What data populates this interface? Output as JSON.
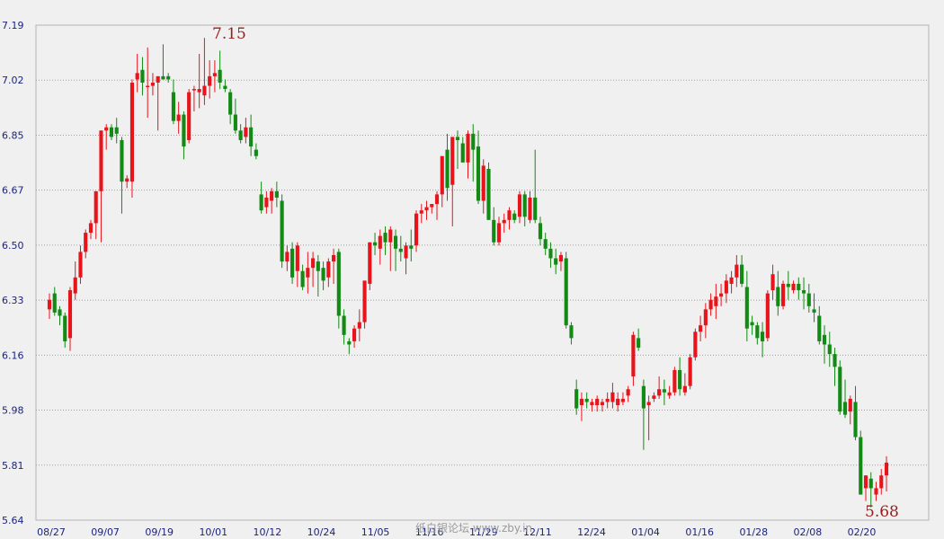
{
  "chart_data": {
    "type": "candlestick",
    "title": "",
    "xlabel": "",
    "ylabel": "",
    "ylim": [
      5.64,
      7.19
    ],
    "yticks": [
      "7.19",
      "7.02",
      "6.85",
      "6.67",
      "6.50",
      "6.33",
      "6.16",
      "5.98",
      "5.81",
      "5.64"
    ],
    "xticks": [
      "08/27",
      "09/07",
      "09/19",
      "10/01",
      "10/12",
      "10/24",
      "11/05",
      "11/16",
      "11/29",
      "12/11",
      "12/24",
      "01/04",
      "01/16",
      "01/28",
      "02/08",
      "02/20"
    ],
    "grid": "horizontal dotted",
    "high_label": "7.15",
    "low_label": "5.68",
    "up_color": "#e8141b",
    "down_color": "#128a14",
    "watermark": "纸白银论坛 www.zby.in",
    "candles": [
      [
        6.3,
        6.35,
        6.27,
        6.33
      ],
      [
        6.35,
        6.37,
        6.28,
        6.29
      ],
      [
        6.3,
        6.31,
        6.25,
        6.28
      ],
      [
        6.28,
        6.29,
        6.18,
        6.2
      ],
      [
        6.21,
        6.37,
        6.17,
        6.36
      ],
      [
        6.35,
        6.45,
        6.33,
        6.4
      ],
      [
        6.4,
        6.5,
        6.38,
        6.48
      ],
      [
        6.48,
        6.55,
        6.46,
        6.54
      ],
      [
        6.54,
        6.58,
        6.52,
        6.57
      ],
      [
        6.57,
        6.67,
        6.52,
        6.67
      ],
      [
        6.67,
        6.86,
        6.51,
        6.86
      ],
      [
        6.86,
        6.88,
        6.8,
        6.87
      ],
      [
        6.87,
        6.88,
        6.83,
        6.84
      ],
      [
        6.87,
        6.9,
        6.82,
        6.85
      ],
      [
        6.83,
        6.84,
        6.6,
        6.7
      ],
      [
        6.7,
        6.72,
        6.68,
        6.71
      ],
      [
        6.7,
        7.02,
        6.65,
        7.01
      ],
      [
        7.02,
        7.1,
        6.98,
        7.04
      ],
      [
        7.05,
        7.09,
        6.97,
        7.01
      ],
      [
        7.0,
        7.12,
        6.9,
        7.0
      ],
      [
        7.0,
        7.04,
        6.97,
        7.01
      ],
      [
        7.01,
        7.03,
        6.86,
        7.03
      ],
      [
        7.03,
        7.13,
        7.02,
        7.02
      ],
      [
        7.03,
        7.04,
        7.01,
        7.02
      ],
      [
        6.98,
        7.02,
        6.88,
        6.89
      ],
      [
        6.89,
        6.95,
        6.85,
        6.91
      ],
      [
        6.91,
        6.92,
        6.77,
        6.81
      ],
      [
        6.83,
        6.99,
        6.82,
        6.98
      ],
      [
        6.99,
        7.0,
        6.92,
        6.99
      ],
      [
        6.98,
        7.1,
        6.93,
        6.99
      ],
      [
        6.97,
        7.15,
        6.94,
        7.0
      ],
      [
        7.0,
        7.08,
        6.96,
        7.03
      ],
      [
        7.03,
        7.08,
        6.98,
        7.04
      ],
      [
        7.05,
        7.11,
        6.99,
        7.01
      ],
      [
        7.0,
        7.02,
        6.98,
        6.99
      ],
      [
        6.98,
        6.99,
        6.88,
        6.91
      ],
      [
        6.91,
        6.96,
        6.85,
        6.86
      ],
      [
        6.86,
        6.88,
        6.82,
        6.83
      ],
      [
        6.84,
        6.9,
        6.82,
        6.87
      ],
      [
        6.87,
        6.91,
        6.78,
        6.81
      ],
      [
        6.8,
        6.82,
        6.77,
        6.78
      ],
      [
        6.66,
        6.7,
        6.6,
        6.61
      ],
      [
        6.62,
        6.67,
        6.6,
        6.65
      ],
      [
        6.64,
        6.68,
        6.6,
        6.67
      ],
      [
        6.67,
        6.7,
        6.62,
        6.65
      ],
      [
        6.64,
        6.66,
        6.43,
        6.45
      ],
      [
        6.45,
        6.5,
        6.42,
        6.48
      ],
      [
        6.49,
        6.51,
        6.38,
        6.4
      ],
      [
        6.42,
        6.51,
        6.37,
        6.5
      ],
      [
        6.42,
        6.44,
        6.36,
        6.37
      ],
      [
        6.4,
        6.48,
        6.35,
        6.43
      ],
      [
        6.43,
        6.48,
        6.37,
        6.46
      ],
      [
        6.45,
        6.47,
        6.34,
        6.42
      ],
      [
        6.43,
        6.45,
        6.36,
        6.39
      ],
      [
        6.4,
        6.46,
        6.37,
        6.45
      ],
      [
        6.45,
        6.49,
        6.38,
        6.47
      ],
      [
        6.48,
        6.49,
        6.24,
        6.28
      ],
      [
        6.28,
        6.3,
        6.19,
        6.22
      ],
      [
        6.2,
        6.21,
        6.16,
        6.19
      ],
      [
        6.2,
        6.25,
        6.18,
        6.24
      ],
      [
        6.24,
        6.3,
        6.2,
        6.26
      ],
      [
        6.26,
        6.39,
        6.24,
        6.39
      ],
      [
        6.38,
        6.51,
        6.36,
        6.51
      ],
      [
        6.51,
        6.54,
        6.47,
        6.5
      ],
      [
        6.49,
        6.55,
        6.44,
        6.53
      ],
      [
        6.54,
        6.56,
        6.47,
        6.51
      ],
      [
        6.51,
        6.56,
        6.42,
        6.55
      ],
      [
        6.53,
        6.55,
        6.42,
        6.49
      ],
      [
        6.49,
        6.53,
        6.45,
        6.48
      ],
      [
        6.46,
        6.51,
        6.41,
        6.5
      ],
      [
        6.5,
        6.55,
        6.45,
        6.49
      ],
      [
        6.5,
        6.61,
        6.48,
        6.6
      ],
      [
        6.6,
        6.63,
        6.57,
        6.61
      ],
      [
        6.61,
        6.64,
        6.58,
        6.62
      ],
      [
        6.62,
        6.63,
        6.6,
        6.63
      ],
      [
        6.63,
        6.67,
        6.58,
        6.66
      ],
      [
        6.66,
        6.78,
        6.62,
        6.78
      ],
      [
        6.8,
        6.85,
        6.64,
        6.68
      ],
      [
        6.69,
        6.84,
        6.56,
        6.84
      ],
      [
        6.84,
        6.86,
        6.74,
        6.83
      ],
      [
        6.82,
        6.84,
        6.76,
        6.76
      ],
      [
        6.76,
        6.86,
        6.71,
        6.85
      ],
      [
        6.85,
        6.88,
        6.7,
        6.8
      ],
      [
        6.81,
        6.86,
        6.63,
        6.64
      ],
      [
        6.64,
        6.77,
        6.6,
        6.75
      ],
      [
        6.74,
        6.76,
        6.58,
        6.58
      ],
      [
        6.58,
        6.62,
        6.5,
        6.51
      ],
      [
        6.51,
        6.59,
        6.5,
        6.57
      ],
      [
        6.57,
        6.6,
        6.54,
        6.58
      ],
      [
        6.58,
        6.62,
        6.55,
        6.61
      ],
      [
        6.6,
        6.61,
        6.57,
        6.58
      ],
      [
        6.59,
        6.67,
        6.57,
        6.66
      ],
      [
        6.66,
        6.67,
        6.56,
        6.59
      ],
      [
        6.58,
        6.67,
        6.57,
        6.65
      ],
      [
        6.65,
        6.8,
        6.57,
        6.58
      ],
      [
        6.57,
        6.59,
        6.5,
        6.52
      ],
      [
        6.52,
        6.54,
        6.47,
        6.49
      ],
      [
        6.49,
        6.51,
        6.43,
        6.46
      ],
      [
        6.46,
        6.49,
        6.41,
        6.44
      ],
      [
        6.45,
        6.48,
        6.42,
        6.47
      ],
      [
        6.46,
        6.48,
        6.24,
        6.25
      ],
      [
        6.25,
        6.26,
        6.19,
        6.21
      ],
      [
        6.05,
        6.08,
        5.97,
        5.99
      ],
      [
        6.0,
        6.04,
        5.95,
        6.02
      ],
      [
        6.02,
        6.04,
        5.99,
        6.01
      ],
      [
        6.0,
        6.02,
        5.98,
        6.01
      ],
      [
        6.0,
        6.03,
        5.98,
        6.02
      ],
      [
        6.0,
        6.02,
        5.98,
        6.01
      ],
      [
        6.01,
        6.04,
        5.99,
        6.02
      ],
      [
        6.01,
        6.07,
        5.99,
        6.04
      ],
      [
        6.0,
        6.04,
        5.98,
        6.02
      ],
      [
        6.01,
        6.04,
        6.0,
        6.02
      ],
      [
        6.03,
        6.06,
        6.01,
        6.05
      ],
      [
        6.09,
        6.23,
        6.06,
        6.22
      ],
      [
        6.21,
        6.24,
        6.17,
        6.18
      ],
      [
        6.06,
        6.08,
        5.86,
        5.99
      ],
      [
        6.0,
        6.03,
        5.89,
        6.01
      ],
      [
        6.02,
        6.04,
        6.01,
        6.03
      ],
      [
        6.03,
        6.09,
        6.02,
        6.05
      ],
      [
        6.05,
        6.08,
        6.0,
        6.04
      ],
      [
        6.03,
        6.06,
        6.02,
        6.04
      ],
      [
        6.04,
        6.12,
        6.03,
        6.11
      ],
      [
        6.11,
        6.15,
        6.03,
        6.05
      ],
      [
        6.04,
        6.1,
        6.03,
        6.06
      ],
      [
        6.06,
        6.16,
        6.05,
        6.15
      ],
      [
        6.15,
        6.24,
        6.14,
        6.23
      ],
      [
        6.23,
        6.28,
        6.2,
        6.25
      ],
      [
        6.25,
        6.32,
        6.21,
        6.3
      ],
      [
        6.3,
        6.35,
        6.28,
        6.33
      ],
      [
        6.31,
        6.38,
        6.27,
        6.34
      ],
      [
        6.34,
        6.38,
        6.31,
        6.35
      ],
      [
        6.35,
        6.41,
        6.32,
        6.39
      ],
      [
        6.38,
        6.42,
        6.35,
        6.4
      ],
      [
        6.4,
        6.47,
        6.37,
        6.44
      ],
      [
        6.44,
        6.47,
        6.37,
        6.38
      ],
      [
        6.37,
        6.42,
        6.2,
        6.24
      ],
      [
        6.26,
        6.28,
        6.22,
        6.25
      ],
      [
        6.25,
        6.26,
        6.19,
        6.21
      ],
      [
        6.23,
        6.26,
        6.15,
        6.2
      ],
      [
        6.21,
        6.36,
        6.2,
        6.35
      ],
      [
        6.36,
        6.44,
        6.33,
        6.41
      ],
      [
        6.37,
        6.42,
        6.28,
        6.31
      ],
      [
        6.31,
        6.39,
        6.3,
        6.38
      ],
      [
        6.38,
        6.42,
        6.33,
        6.37
      ],
      [
        6.36,
        6.39,
        6.35,
        6.38
      ],
      [
        6.38,
        6.4,
        6.33,
        6.36
      ],
      [
        6.36,
        6.4,
        6.3,
        6.35
      ],
      [
        6.35,
        6.38,
        6.29,
        6.31
      ],
      [
        6.3,
        6.35,
        6.26,
        6.29
      ],
      [
        6.28,
        6.31,
        6.19,
        6.2
      ],
      [
        6.22,
        6.25,
        6.13,
        6.19
      ],
      [
        6.19,
        6.23,
        6.12,
        6.16
      ],
      [
        6.16,
        6.18,
        6.06,
        6.12
      ],
      [
        6.12,
        6.14,
        5.97,
        5.98
      ],
      [
        6.01,
        6.08,
        5.96,
        5.97
      ],
      [
        5.98,
        6.03,
        5.94,
        6.02
      ],
      [
        6.01,
        6.06,
        5.89,
        5.9
      ],
      [
        5.9,
        5.92,
        5.72,
        5.72
      ],
      [
        5.74,
        5.78,
        5.7,
        5.78
      ],
      [
        5.77,
        5.79,
        5.68,
        5.74
      ],
      [
        5.72,
        5.76,
        5.7,
        5.74
      ],
      [
        5.74,
        5.8,
        5.72,
        5.78
      ],
      [
        5.78,
        5.84,
        5.73,
        5.82
      ]
    ]
  }
}
